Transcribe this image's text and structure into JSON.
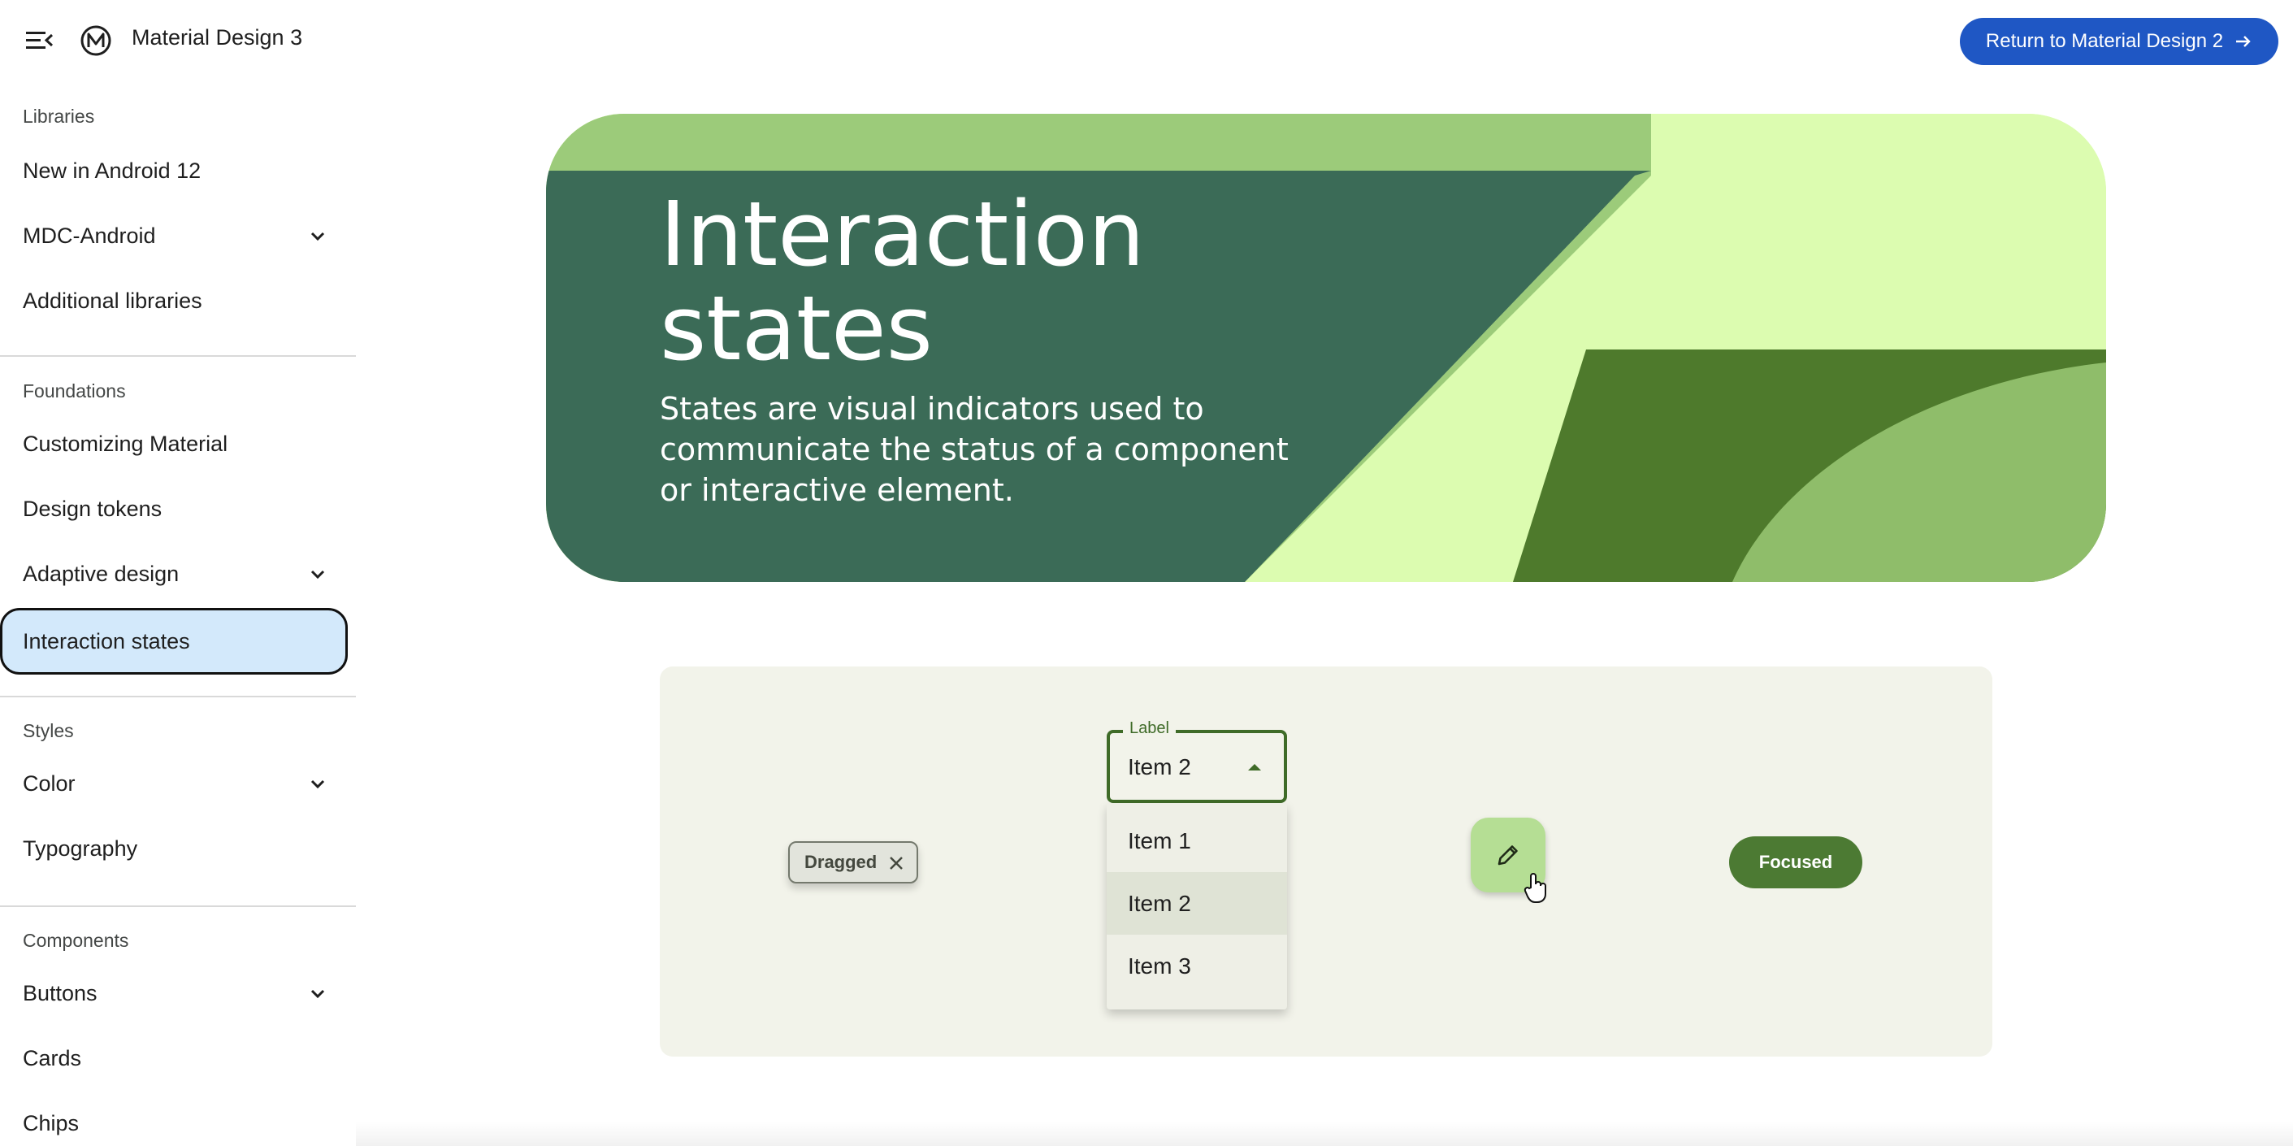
{
  "header": {
    "app_title": "Material Design 3",
    "return_button": "Return to Material Design 2",
    "icons": [
      "menu-icon",
      "material-logo-icon",
      "arrow-right-icon"
    ],
    "accent_color": "#1f57c4"
  },
  "sidebar": {
    "sections": [
      {
        "title": "Libraries",
        "items": [
          {
            "label": "New in Android 12",
            "expandable": false
          },
          {
            "label": "MDC-Android",
            "expandable": true
          },
          {
            "label": "Additional libraries",
            "expandable": false
          }
        ]
      },
      {
        "title": "Foundations",
        "items": [
          {
            "label": "Customizing Material",
            "expandable": false
          },
          {
            "label": "Design tokens",
            "expandable": false
          },
          {
            "label": "Adaptive design",
            "expandable": true
          },
          {
            "label": "Interaction states",
            "expandable": false,
            "active": true
          }
        ]
      },
      {
        "title": "Styles",
        "items": [
          {
            "label": "Color",
            "expandable": true
          },
          {
            "label": "Typography",
            "expandable": false
          }
        ]
      },
      {
        "title": "Components",
        "items": [
          {
            "label": "Buttons",
            "expandable": true
          },
          {
            "label": "Cards",
            "expandable": false
          },
          {
            "label": "Chips",
            "expandable": false
          }
        ]
      }
    ]
  },
  "hero": {
    "title": "Interaction states",
    "subtitle": "States are visual indicators used to communicate the status of a component or interactive element."
  },
  "demo": {
    "chip_label": "Dragged",
    "select": {
      "label": "Label",
      "value": "Item 2",
      "options": [
        "Item 1",
        "Item 2",
        "Item 3"
      ]
    },
    "fab_icon": "pencil-icon",
    "focused_button": "Focused"
  }
}
